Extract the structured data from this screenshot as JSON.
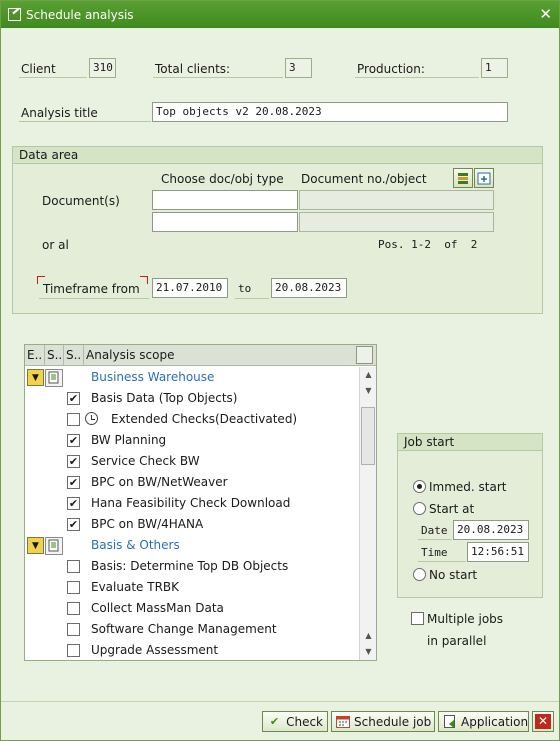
{
  "window": {
    "title": "Schedule analysis"
  },
  "header": {
    "client_label": "Client",
    "client_value": "310",
    "total_clients_label": "Total clients:",
    "total_clients_value": "3",
    "production_label": "Production:",
    "production_value": "1",
    "analysis_title_label": "Analysis title",
    "analysis_title_value": "Top objects v2 20.08.2023"
  },
  "data_area": {
    "title": "Data area",
    "col_choose": "Choose doc/obj type",
    "col_docno": "Document no./object",
    "documents_label": "Document(s)",
    "or_all_label": "or al",
    "pos_label": "Pos. 1-2  of  2",
    "timeframe_label": "Timeframe from",
    "timeframe_from": "21.07.2010",
    "to_label": "to",
    "timeframe_to": "20.08.2023"
  },
  "scope": {
    "columns": [
      "E..",
      "S..",
      "S..",
      "Analysis scope"
    ],
    "groups": [
      {
        "label": "Business Warehouse",
        "items": [
          {
            "label": "Basis Data (Top Objects)",
            "checked": true
          },
          {
            "label": "Extended Checks(Deactivated)",
            "checked": false,
            "clock": true
          },
          {
            "label": "BW Planning",
            "checked": true
          },
          {
            "label": "Service Check BW",
            "checked": true
          },
          {
            "label": "BPC on BW/NetWeaver",
            "checked": true
          },
          {
            "label": "Hana Feasibility Check Download",
            "checked": true
          },
          {
            "label": "BPC on BW/4HANA",
            "checked": true
          }
        ]
      },
      {
        "label": "Basis & Others",
        "items": [
          {
            "label": "Basis: Determine Top DB Objects",
            "checked": false
          },
          {
            "label": "Evaluate TRBK",
            "checked": false
          },
          {
            "label": "Collect MassMan Data",
            "checked": false
          },
          {
            "label": "Software Change Management",
            "checked": false
          },
          {
            "label": "Upgrade Assessment",
            "checked": false
          }
        ]
      }
    ]
  },
  "job_start": {
    "title": "Job start",
    "immed_label": "Immed. start",
    "start_at_label": "Start at",
    "date_label": "Date",
    "date_value": "20.08.2023",
    "time_label": "Time",
    "time_value": "12:56:51",
    "no_start_label": "No start",
    "selected": "immed"
  },
  "multiple_jobs_label_1": "Multiple jobs",
  "multiple_jobs_label_2": "in parallel",
  "buttons": {
    "check": "Check",
    "schedule": "Schedule job",
    "application": "Application"
  },
  "colors": {
    "titlebar": "#4a9528",
    "window_bg": "#e9f2e1",
    "link_blue": "#2a6fb5",
    "cancel_red": "#c0281c"
  }
}
